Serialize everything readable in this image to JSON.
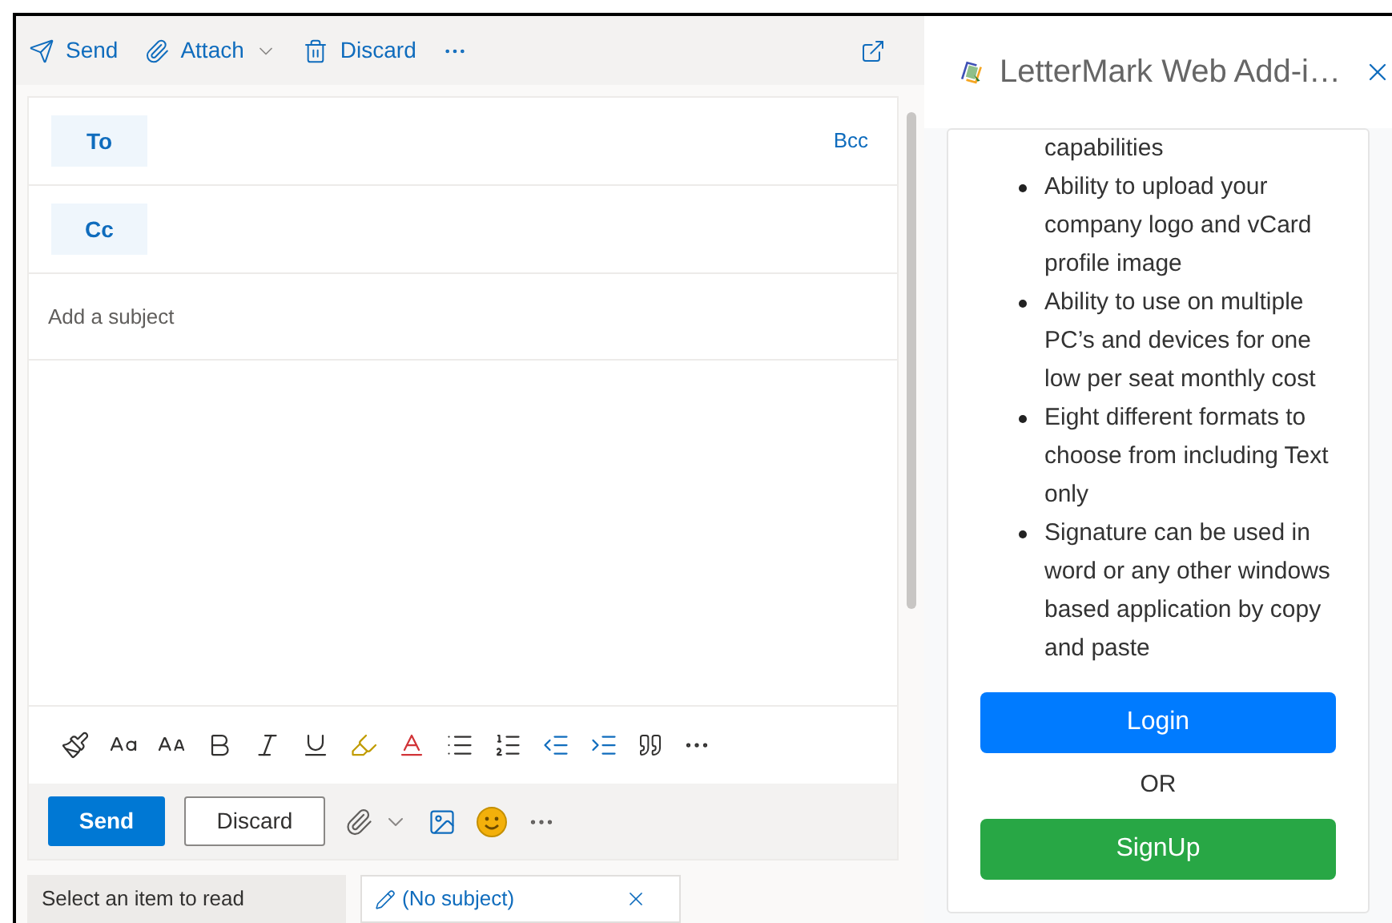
{
  "toolbar": {
    "items": [
      {
        "label": "Send",
        "kind": "send"
      },
      {
        "label": "Attach",
        "kind": "attach"
      },
      {
        "label": "Discard",
        "kind": "discard"
      }
    ]
  },
  "compose": {
    "to_label": "To",
    "bcc": "Bcc",
    "cc_label": "Cc",
    "subject": {
      "placeholder": "Add a subject"
    },
    "send": "Send",
    "discard": "Discard"
  },
  "tabs": [
    {
      "label": "Select an item to read",
      "selected": false
    },
    {
      "label": "(No subject)",
      "selected": true
    }
  ],
  "addin": {
    "title": "LetterMark Web Add-i…",
    "features": [
      {
        "kind": "continuation",
        "text": "capabilities"
      },
      {
        "kind": "bullet",
        "text": "Ability to upload your company logo and vCard profile image"
      },
      {
        "kind": "bullet",
        "text": "Ability to use on multiple PC’s and devices for one low per seat monthly cost"
      },
      {
        "kind": "bullet",
        "text": "Eight different formats to choose from including Text only"
      },
      {
        "kind": "bullet",
        "text": "Signature can be used in word or any other windows based application by copy and paste"
      }
    ],
    "login": "Login",
    "or": "OR",
    "signup": "SignUp"
  }
}
